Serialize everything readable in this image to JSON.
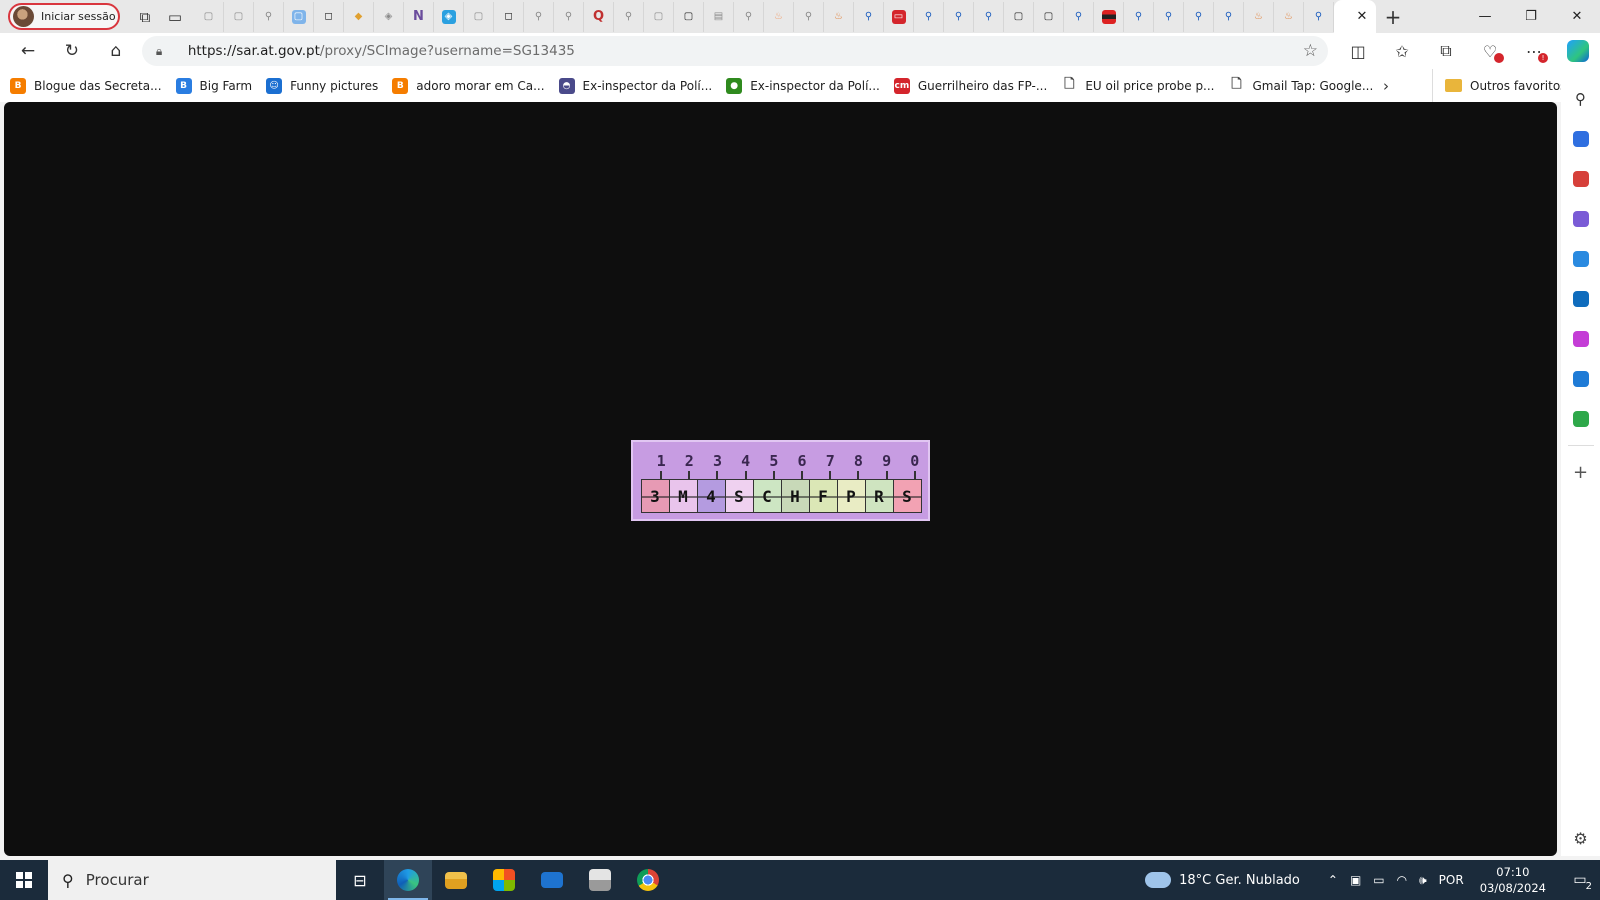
{
  "browser": {
    "profile_label": "Iniciar sessão",
    "url_host": "https://sar.at.gov.pt",
    "url_path": "/proxy/SCImage?username=SG13435",
    "close_tab_glyph": "✕",
    "new_tab_glyph": "+",
    "window_controls": [
      "—",
      "❐",
      "✕"
    ]
  },
  "bookmarks": {
    "items": [
      {
        "label": "Blogue das Secreta...",
        "icon_color": "#f57d00",
        "icon_glyph": "B"
      },
      {
        "label": "Big Farm",
        "icon_color": "#2a7de1",
        "icon_glyph": "B"
      },
      {
        "label": "Funny pictures",
        "icon_color": "#1b6fd1",
        "icon_glyph": "☺"
      },
      {
        "label": "adoro morar em Ca...",
        "icon_color": "#f57d00",
        "icon_glyph": "B"
      },
      {
        "label": "Ex-inspector da Polí...",
        "icon_color": "#4a4a8a",
        "icon_glyph": "◓"
      },
      {
        "label": "Ex-inspector da Polí...",
        "icon_color": "#2f8a1e",
        "icon_glyph": "●"
      },
      {
        "label": "Guerrilheiro das FP-...",
        "icon_color": "#d4252c",
        "icon_glyph": "cm"
      },
      {
        "label": "EU oil price probe p...",
        "icon_color": "#ffffff",
        "icon_glyph": "🗋"
      },
      {
        "label": "Gmail Tap: Google...",
        "icon_color": "#ffffff",
        "icon_glyph": "🗋"
      }
    ],
    "more_glyph": "›",
    "folder_label": "Outros favoritos"
  },
  "captcha": {
    "numbers": [
      "1",
      "2",
      "3",
      "4",
      "5",
      "6",
      "7",
      "8",
      "9",
      "0"
    ],
    "characters": [
      "3",
      "M",
      "4",
      "S",
      "C",
      "H",
      "F",
      "P",
      "R",
      "S"
    ],
    "cell_colors": [
      "#e79ab4",
      "#e9c4ec",
      "#b49be0",
      "#efd1f0",
      "#cde6c3",
      "#c8d9b8",
      "#dbe7b6",
      "#e9ecc4",
      "#cfe4c0",
      "#f2a2b3"
    ],
    "background": "#c79ce2"
  },
  "sidebar": {
    "icons": [
      {
        "name": "shopping-icon",
        "color": "#2f6fe0"
      },
      {
        "name": "tools-icon",
        "color": "#d6403a"
      },
      {
        "name": "games-icon",
        "color": "#7a5bd6"
      },
      {
        "name": "office-icon",
        "color": "#2a8ae0"
      },
      {
        "name": "outlook-icon",
        "color": "#0f6cbd"
      },
      {
        "name": "designer-icon",
        "color": "#c43dd6"
      },
      {
        "name": "send-icon",
        "color": "#1f7bd6"
      },
      {
        "name": "tree-icon",
        "color": "#2ea84a"
      }
    ]
  },
  "taskbar": {
    "search_placeholder": "Procurar",
    "weather": "18°C  Ger. Nublado",
    "language": "POR",
    "time": "07:10",
    "date": "03/08/2024",
    "notifications": "2"
  }
}
